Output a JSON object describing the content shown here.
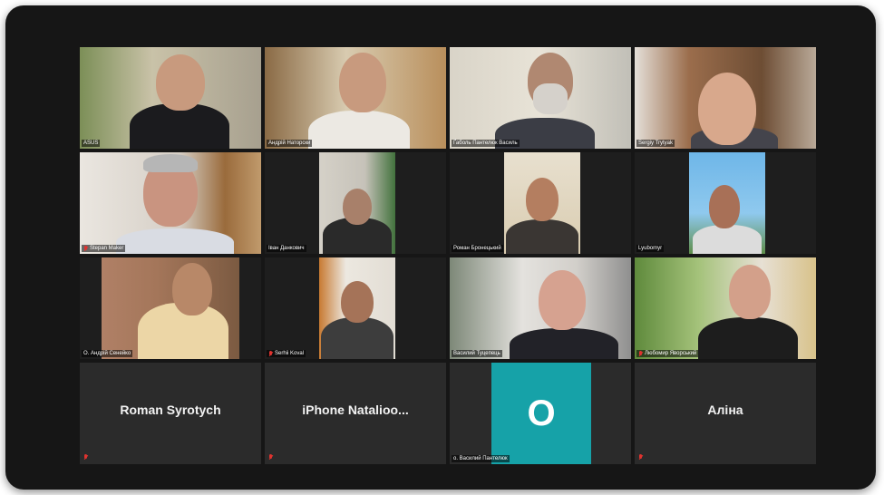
{
  "meeting": {
    "participants": [
      {
        "name": "ASUS",
        "muted": false
      },
      {
        "name": "Андрій Наторски",
        "muted": false
      },
      {
        "name": "Ґаболь Пантелюк Василь",
        "muted": false
      },
      {
        "name": "Sergiy Trytyak",
        "muted": false
      },
      {
        "name": "Stepan Maker",
        "muted": true
      },
      {
        "name": "Іван Данкович",
        "muted": false
      },
      {
        "name": "Роман Бронецький",
        "muted": false
      },
      {
        "name": "Lyubomyr",
        "muted": false
      },
      {
        "name": "О. Андрій Сенейко",
        "muted": false
      },
      {
        "name": "Serhii Koval",
        "muted": true
      },
      {
        "name": "Василий Туцепець",
        "muted": false,
        "active_speaker": true
      },
      {
        "name": "Любомир Яворський",
        "muted": true
      },
      {
        "name": "Roman Syrotych",
        "muted": true,
        "video": false
      },
      {
        "name": "iPhone  Natalioo...",
        "muted": true,
        "video": false
      },
      {
        "name": "о. Василий Пантелюк",
        "muted": false,
        "video": false,
        "avatar_letter": "O"
      },
      {
        "name": "Аліна",
        "muted": true,
        "video": false
      }
    ]
  },
  "colors": {
    "frame": "#161616",
    "tile": "#1e1e1e",
    "active_border": "#cfd24a",
    "avatar_bg": "#16a2a8",
    "mute_icon": "#e0332f"
  }
}
